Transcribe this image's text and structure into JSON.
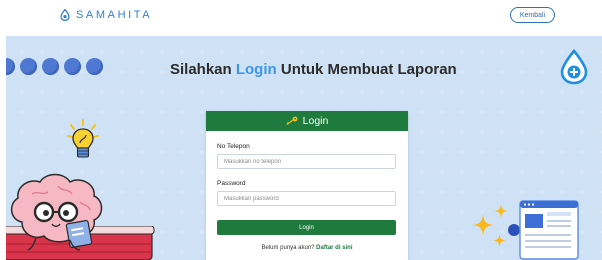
{
  "header": {
    "brand": "SAMAHITA",
    "back_label": "Kembali"
  },
  "hero": {
    "title_prefix": "Silahkan ",
    "title_highlight": "Login",
    "title_suffix": " Untuk Membuat Laporan"
  },
  "login": {
    "header_label": "Login",
    "phone_label": "No Telepon",
    "phone_placeholder": "Masukkan no telepon",
    "password_label": "Password",
    "password_placeholder": "Masukkan password",
    "submit_label": "Login",
    "signup_text": "Belum punya akun? ",
    "signup_link": "Daftar di sini"
  },
  "colors": {
    "brand_blue": "#2f7fd6",
    "primary_green": "#1e7b3d",
    "hero_bg": "#cfe2f5",
    "highlight_blue": "#3e97e8"
  },
  "icons": {
    "brand": "water-drop-icon",
    "card_header": "key-icon",
    "badge": "drop-plus-icon"
  }
}
